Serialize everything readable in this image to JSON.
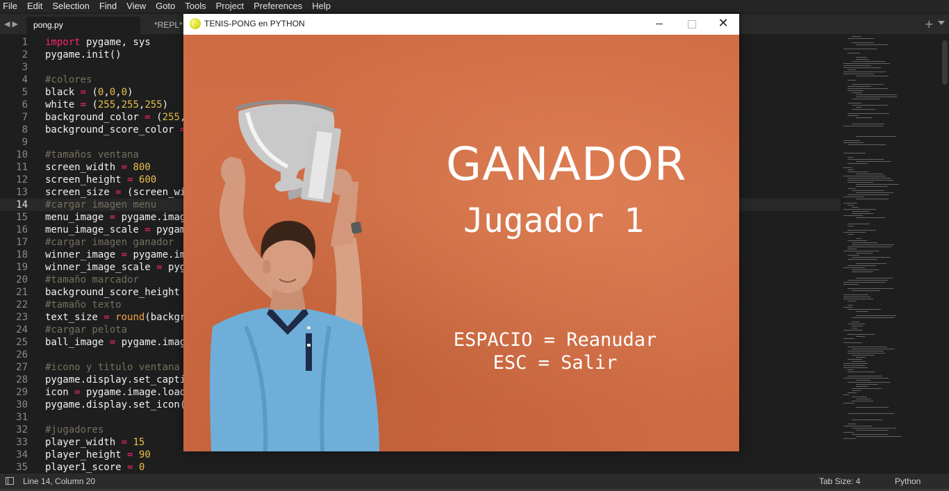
{
  "menubar": {
    "items": [
      "File",
      "Edit",
      "Selection",
      "Find",
      "View",
      "Goto",
      "Tools",
      "Project",
      "Preferences",
      "Help"
    ]
  },
  "tabs": {
    "active": "pong.py",
    "inactive": "*REPL* [p"
  },
  "editor": {
    "line_numbers": [
      "1",
      "2",
      "3",
      "4",
      "5",
      "6",
      "7",
      "8",
      "9",
      "10",
      "11",
      "12",
      "13",
      "14",
      "15",
      "16",
      "17",
      "18",
      "19",
      "20",
      "21",
      "22",
      "23",
      "24",
      "25",
      "26",
      "27",
      "28",
      "29",
      "30",
      "31",
      "32",
      "33",
      "34",
      "35"
    ],
    "current_line": 14,
    "lines": [
      [
        [
          "k",
          "import"
        ],
        [
          "p",
          " pygame, sys"
        ]
      ],
      [
        [
          "p",
          "pygame.init()"
        ]
      ],
      [],
      [
        [
          "c",
          "#colores"
        ]
      ],
      [
        [
          "p",
          "black "
        ],
        [
          "o",
          "="
        ],
        [
          "p",
          " ("
        ],
        [
          "n",
          "0"
        ],
        [
          "p",
          ","
        ],
        [
          "n",
          "0"
        ],
        [
          "p",
          ","
        ],
        [
          "n",
          "0"
        ],
        [
          "p",
          ")"
        ]
      ],
      [
        [
          "p",
          "white "
        ],
        [
          "o",
          "="
        ],
        [
          "p",
          " ("
        ],
        [
          "n",
          "255"
        ],
        [
          "p",
          ","
        ],
        [
          "n",
          "255"
        ],
        [
          "p",
          ","
        ],
        [
          "n",
          "255"
        ],
        [
          "p",
          ")"
        ]
      ],
      [
        [
          "p",
          "background_color "
        ],
        [
          "o",
          "="
        ],
        [
          "p",
          " ("
        ],
        [
          "n",
          "255"
        ],
        [
          "p",
          ","
        ]
      ],
      [
        [
          "p",
          "background_score_color "
        ],
        [
          "o",
          "="
        ]
      ],
      [],
      [
        [
          "c",
          "#tamaños ventana"
        ]
      ],
      [
        [
          "p",
          "screen_width "
        ],
        [
          "o",
          "="
        ],
        [
          "p",
          " "
        ],
        [
          "n",
          "800"
        ]
      ],
      [
        [
          "p",
          "screen_height "
        ],
        [
          "o",
          "="
        ],
        [
          "p",
          " "
        ],
        [
          "n",
          "600"
        ]
      ],
      [
        [
          "p",
          "screen_size "
        ],
        [
          "o",
          "="
        ],
        [
          "p",
          " (screen_wi"
        ]
      ],
      [
        [
          "c",
          "#cargar imagen menu"
        ]
      ],
      [
        [
          "p",
          "menu_image "
        ],
        [
          "o",
          "="
        ],
        [
          "p",
          " pygame.imag"
        ]
      ],
      [
        [
          "p",
          "menu_image_scale "
        ],
        [
          "o",
          "="
        ],
        [
          "p",
          " pygam"
        ]
      ],
      [
        [
          "c",
          "#cargar imagen ganador"
        ]
      ],
      [
        [
          "p",
          "winner_image "
        ],
        [
          "o",
          "="
        ],
        [
          "p",
          " pygame.im"
        ]
      ],
      [
        [
          "p",
          "winner_image_scale "
        ],
        [
          "o",
          "="
        ],
        [
          "p",
          " pyg"
        ]
      ],
      [
        [
          "c",
          "#tamaño marcador"
        ]
      ],
      [
        [
          "p",
          "background_score_height "
        ]
      ],
      [
        [
          "c",
          "#tamaño texto"
        ]
      ],
      [
        [
          "p",
          "text_size "
        ],
        [
          "o",
          "="
        ],
        [
          "p",
          " "
        ],
        [
          "f",
          "round"
        ],
        [
          "p",
          "(backgr"
        ]
      ],
      [
        [
          "c",
          "#cargar pelota"
        ]
      ],
      [
        [
          "p",
          "ball_image "
        ],
        [
          "o",
          "="
        ],
        [
          "p",
          " pygame.imag"
        ]
      ],
      [],
      [
        [
          "c",
          "#icono y titulo ventana"
        ]
      ],
      [
        [
          "p",
          "pygame.display.set_capti"
        ]
      ],
      [
        [
          "p",
          "icon "
        ],
        [
          "o",
          "="
        ],
        [
          "p",
          " pygame.image.load"
        ]
      ],
      [
        [
          "p",
          "pygame.display.set_icon("
        ]
      ],
      [],
      [
        [
          "c",
          "#jugadores"
        ]
      ],
      [
        [
          "p",
          "player_width "
        ],
        [
          "o",
          "="
        ],
        [
          "p",
          " "
        ],
        [
          "n",
          "15"
        ]
      ],
      [
        [
          "p",
          "player_height "
        ],
        [
          "o",
          "="
        ],
        [
          "p",
          " "
        ],
        [
          "n",
          "90"
        ]
      ],
      [
        [
          "p",
          "player1_score "
        ],
        [
          "o",
          "="
        ],
        [
          "p",
          " "
        ],
        [
          "n",
          "0"
        ]
      ]
    ]
  },
  "statusbar": {
    "position": "Line 14, Column 20",
    "tab_size": "Tab Size: 4",
    "syntax": "Python"
  },
  "game_window": {
    "title": "TENIS-PONG en PYTHON",
    "close_symbol": "✕",
    "heading": "GANADOR",
    "winner": "Jugador 1",
    "option_resume": "ESPACIO = Reanudar",
    "option_exit": "ESC = Salir"
  },
  "colors": {
    "editor_bg": "#1e1e1e",
    "keyword": "#f92672",
    "comment": "#75715e",
    "number": "#e6c04a",
    "clay_court": "#cf6c44",
    "shirt": "#6eaed8"
  }
}
